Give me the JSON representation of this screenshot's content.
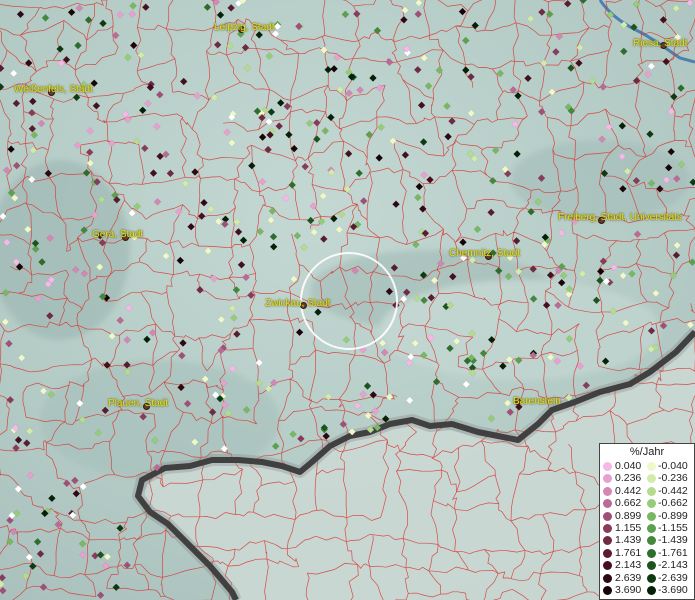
{
  "colors": {
    "background": "#b8cec9",
    "boundary_lines": "#d8332f",
    "label_text": "#e6e21a",
    "zoom_circle": "#ffffff"
  },
  "cities": [
    {
      "name": "Leipzig, Stadt"
    },
    {
      "name": "Riesa, Stadt"
    },
    {
      "name": "Weißenfels, Stadt"
    },
    {
      "name": "Gera, Stadt"
    },
    {
      "name": "Freiberg, Stadt, Universitäts"
    },
    {
      "name": "Chemnitz, Stadt"
    },
    {
      "name": "Zwickau, Stadt"
    },
    {
      "name": "Plauen, Stadt"
    },
    {
      "name": "Barenstein"
    }
  ],
  "legend": {
    "title": "%/Jahr",
    "positive": [
      {
        "label": "0.040",
        "color": "#f5b8e8"
      },
      {
        "label": "0.236",
        "color": "#e8a0d0"
      },
      {
        "label": "0.442",
        "color": "#d486b4"
      },
      {
        "label": "0.662",
        "color": "#bb6a96"
      },
      {
        "label": "0.899",
        "color": "#a05078"
      },
      {
        "label": "1.155",
        "color": "#883c5c"
      },
      {
        "label": "1.439",
        "color": "#702a44"
      },
      {
        "label": "1.761",
        "color": "#5a1c30"
      },
      {
        "label": "2.143",
        "color": "#44101f"
      },
      {
        "label": "2.639",
        "color": "#2e0812"
      },
      {
        "label": "3.690",
        "color": "#180306"
      }
    ],
    "negative": [
      {
        "label": "-0.040",
        "color": "#eef8c8"
      },
      {
        "label": "-0.236",
        "color": "#d2ebaa"
      },
      {
        "label": "-0.442",
        "color": "#b4dc8e"
      },
      {
        "label": "-0.662",
        "color": "#96cc78"
      },
      {
        "label": "-0.899",
        "color": "#78b862"
      },
      {
        "label": "-1.155",
        "color": "#5ca24e"
      },
      {
        "label": "-1.439",
        "color": "#44883c"
      },
      {
        "label": "-1.761",
        "color": "#2e6e2c"
      },
      {
        "label": "-2.143",
        "color": "#1c541e"
      },
      {
        "label": "-2.639",
        "color": "#0e3a12"
      },
      {
        "label": "-3.690",
        "color": "#042006"
      }
    ]
  }
}
